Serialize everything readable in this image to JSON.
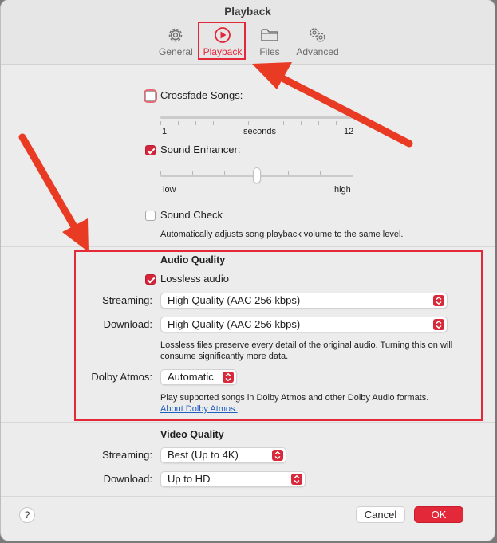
{
  "window": {
    "title": "Playback"
  },
  "tabs": [
    {
      "label": "General",
      "icon": "gear-icon"
    },
    {
      "label": "Playback",
      "icon": "play-circle-icon"
    },
    {
      "label": "Files",
      "icon": "folder-icon"
    },
    {
      "label": "Advanced",
      "icon": "gears-icon"
    }
  ],
  "crossfade": {
    "label": "Crossfade Songs:",
    "checked": false,
    "min_label": "1",
    "mid_label": "seconds",
    "max_label": "12"
  },
  "sound_enhancer": {
    "label": "Sound Enhancer:",
    "checked": true,
    "min_label": "low",
    "max_label": "high",
    "level_fraction": 0.5
  },
  "sound_check": {
    "label": "Sound Check",
    "checked": false,
    "description": "Automatically adjusts song playback volume to the same level."
  },
  "audio_quality": {
    "heading": "Audio Quality",
    "lossless_label": "Lossless audio",
    "lossless_checked": true,
    "streaming_label": "Streaming:",
    "streaming_value": "High Quality (AAC 256 kbps)",
    "download_label": "Download:",
    "download_value": "High Quality (AAC 256 kbps)",
    "lossless_note": "Lossless files preserve every detail of the original audio. Turning this on will consume significantly more data.",
    "dolby_label": "Dolby Atmos:",
    "dolby_value": "Automatic",
    "dolby_note": "Play supported songs in Dolby Atmos and other Dolby Audio formats.",
    "dolby_link": "About Dolby Atmos."
  },
  "video_quality": {
    "heading": "Video Quality",
    "streaming_label": "Streaming:",
    "streaming_value": "Best (Up to 4K)",
    "download_label": "Download:",
    "download_value": "Up to HD"
  },
  "footer": {
    "help_label": "?",
    "cancel_label": "Cancel",
    "ok_label": "OK"
  },
  "colors": {
    "accent": "#e3283a",
    "window_bg": "#ececec",
    "link": "#1f5fbf"
  }
}
